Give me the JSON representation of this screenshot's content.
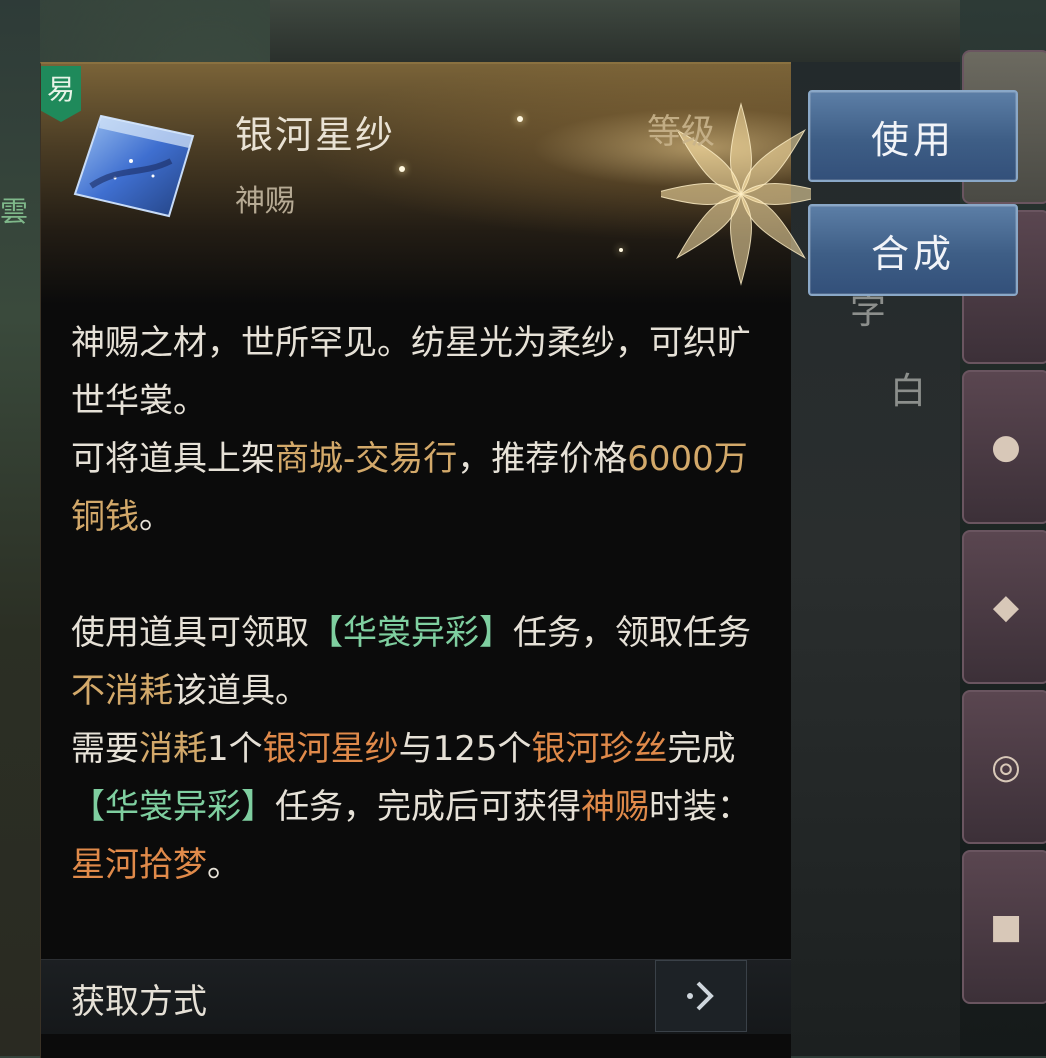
{
  "background": {
    "left_text": "雲",
    "right_texts": [
      "字",
      "白"
    ]
  },
  "tooltip": {
    "tag": "易",
    "item_name": "银河星纱",
    "item_type": "神赐",
    "level_label": "等级",
    "description": [
      [
        {
          "t": "神赐之材，世所罕见。纺星光为柔纱，可织旷世华裳。",
          "c": ""
        }
      ],
      [
        {
          "t": "可将道具上架",
          "c": ""
        },
        {
          "t": "商城-交易行",
          "c": "gold"
        },
        {
          "t": "，推荐价格",
          "c": ""
        },
        {
          "t": "6000万铜钱",
          "c": "gold"
        },
        {
          "t": "。",
          "c": ""
        }
      ],
      [
        {
          "t": " ",
          "c": ""
        }
      ],
      [
        {
          "t": "使用道具可领取",
          "c": ""
        },
        {
          "t": "【华裳异彩】",
          "c": "green"
        },
        {
          "t": "任务，领取任务",
          "c": ""
        },
        {
          "t": "不消耗",
          "c": "gold"
        },
        {
          "t": "该道具。",
          "c": ""
        }
      ],
      [
        {
          "t": "需要",
          "c": ""
        },
        {
          "t": "消耗",
          "c": "gold"
        },
        {
          "t": "1个",
          "c": ""
        },
        {
          "t": "银河星纱",
          "c": "orange"
        },
        {
          "t": "与125个",
          "c": ""
        },
        {
          "t": "银河珍丝",
          "c": "orange"
        },
        {
          "t": "完成",
          "c": ""
        },
        {
          "t": "【华裳异彩】",
          "c": "green"
        },
        {
          "t": "任务，完成后可获得",
          "c": ""
        },
        {
          "t": "神赐",
          "c": "orange"
        },
        {
          "t": "时装：",
          "c": ""
        },
        {
          "t": "星河拾梦",
          "c": "orange"
        },
        {
          "t": "。",
          "c": ""
        }
      ]
    ],
    "acquire_label": "获取方式",
    "acquire_icon": "chevron-right-icon"
  },
  "actions": {
    "use_label": "使用",
    "compose_label": "合成"
  },
  "colors": {
    "gold_text": "#d3a96a",
    "orange_text": "#e08a4a",
    "green_text": "#7fcfa0",
    "button_blue": "#3e5e86"
  }
}
